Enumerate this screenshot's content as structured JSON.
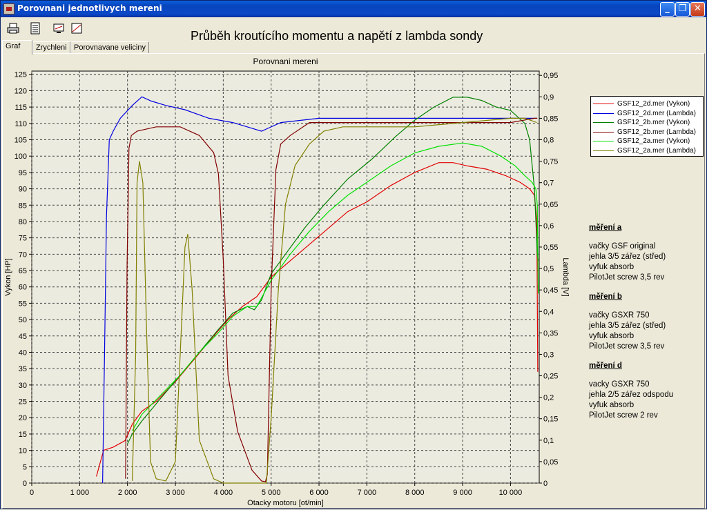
{
  "window": {
    "title": "Porovnani jednotlivych mereni",
    "controls": {
      "minimize": "_",
      "maximize": "❐",
      "close": "✕"
    }
  },
  "toolbar": {
    "buttons": [
      {
        "icon": "print-icon"
      },
      {
        "icon": "list-icon"
      },
      {
        "icon": "monitor-icon"
      },
      {
        "icon": "chart-icon"
      }
    ]
  },
  "heading": "Průběh kroutícího momentu a napětí z lambda sondy",
  "tabs": [
    {
      "label": "Graf",
      "active": true
    },
    {
      "label": "Zrychleni",
      "active": false
    },
    {
      "label": "Porovnavane veliciny",
      "active": false
    }
  ],
  "chart_data": {
    "type": "line",
    "title": "Porovnani mereni",
    "xlabel": "Otacky motoru [ot/min]",
    "ylabel": "Vykon [HP]",
    "y2label": "Lambda [V]",
    "xlim": [
      0,
      10600
    ],
    "ylim": [
      0,
      126
    ],
    "y2lim": [
      0,
      0.96
    ],
    "xticks": [
      0,
      1000,
      2000,
      3000,
      4000,
      5000,
      6000,
      7000,
      8000,
      9000,
      10000
    ],
    "xtick_labels": [
      "0",
      "1 000",
      "2 000",
      "3 000",
      "4 000",
      "5 000",
      "6 000",
      "7 000",
      "8 000",
      "9 000",
      "10 000"
    ],
    "yticks": [
      0,
      5,
      10,
      15,
      20,
      25,
      30,
      35,
      40,
      45,
      50,
      55,
      60,
      65,
      70,
      75,
      80,
      85,
      90,
      95,
      100,
      105,
      110,
      115,
      120,
      125
    ],
    "y2ticks": [
      0,
      0.05,
      0.1,
      0.15,
      0.2,
      0.25,
      0.3,
      0.35,
      0.4,
      0.45,
      0.5,
      0.55,
      0.6,
      0.65,
      0.7,
      0.75,
      0.8,
      0.85,
      0.9,
      0.95
    ],
    "y2tick_labels": [
      "0",
      "0,05",
      "0,1",
      "0,15",
      "0,2",
      "0,25",
      "0,3",
      "0,35",
      "0,4",
      "0,45",
      "0,5",
      "0,55",
      "0,6",
      "0,65",
      "0,7",
      "0,75",
      "0,8",
      "0,85",
      "0,9",
      "0,95"
    ],
    "grid": true,
    "legend_position": "right",
    "series": [
      {
        "name": "GSF12_2d.mer  (Vykon)",
        "color": "#e00000",
        "axis": "left",
        "x": [
          1350,
          1500,
          1700,
          1950,
          2100,
          2300,
          2600,
          3000,
          3400,
          3800,
          4100,
          4400,
          4700,
          5000,
          5400,
          5800,
          6200,
          6600,
          7000,
          7500,
          8000,
          8500,
          8800,
          9100,
          9500,
          9900,
          10200,
          10400,
          10500,
          10550,
          10570
        ],
        "y": [
          2,
          10,
          11,
          13,
          18,
          22,
          25,
          31,
          38,
          45,
          50,
          54,
          57,
          63,
          68,
          73,
          78,
          83,
          86,
          91,
          95,
          98,
          98,
          97,
          96,
          94,
          92,
          90,
          88,
          80,
          34
        ]
      },
      {
        "name": "GSF12_2d.mer  (Lambda)",
        "color": "#0000e0",
        "axis": "right",
        "x": [
          1480,
          1520,
          1560,
          1620,
          1700,
          1850,
          2100,
          2300,
          2500,
          2800,
          3200,
          3700,
          4200,
          4500,
          4800,
          5200,
          6000,
          7000,
          8000,
          9000,
          9600,
          10000,
          10400,
          10550
        ],
        "y": [
          0,
          0.3,
          0.62,
          0.8,
          0.82,
          0.85,
          0.88,
          0.9,
          0.89,
          0.88,
          0.87,
          0.85,
          0.84,
          0.83,
          0.82,
          0.84,
          0.85,
          0.85,
          0.85,
          0.85,
          0.85,
          0.85,
          0.85,
          0.85
        ]
      },
      {
        "name": "GSF12_2b.mer  (Vykon)",
        "color": "#008000",
        "axis": "left",
        "x": [
          2000,
          2100,
          2300,
          2700,
          3100,
          3500,
          3900,
          4200,
          4500,
          4650,
          4800,
          5000,
          5300,
          5700,
          6100,
          6600,
          7100,
          7600,
          8000,
          8400,
          8800,
          9100,
          9400,
          9700,
          10000,
          10300,
          10400,
          10500,
          10560,
          10580
        ],
        "y": [
          12,
          15,
          19,
          26,
          33,
          40,
          47,
          52,
          54,
          53,
          56,
          64,
          70,
          78,
          85,
          93,
          99,
          106,
          111,
          115,
          118,
          118,
          117,
          115,
          114,
          110,
          105,
          90,
          70,
          68
        ]
      },
      {
        "name": "GSF12_2b.mer  (Lambda)",
        "color": "#800000",
        "axis": "right",
        "x": [
          1960,
          1990,
          2030,
          2080,
          2200,
          2600,
          3100,
          3500,
          3800,
          3900,
          4000,
          4100,
          4300,
          4600,
          4800,
          4880,
          4920,
          5000,
          5100,
          5200,
          5400,
          5800,
          6400,
          7000,
          8000,
          9000,
          10000,
          10500,
          10560
        ],
        "y": [
          0.01,
          0.5,
          0.78,
          0.81,
          0.82,
          0.83,
          0.83,
          0.81,
          0.77,
          0.72,
          0.52,
          0.25,
          0.12,
          0.03,
          0.005,
          0.003,
          0.02,
          0.45,
          0.73,
          0.79,
          0.81,
          0.84,
          0.84,
          0.84,
          0.84,
          0.84,
          0.84,
          0.85,
          0.85
        ]
      },
      {
        "name": "GSF12_2a.mer  (Vykon)",
        "color": "#00e000",
        "axis": "left",
        "x": [
          2100,
          2300,
          2700,
          3100,
          3500,
          3900,
          4200,
          4500,
          4700,
          5000,
          5400,
          5800,
          6200,
          6600,
          7000,
          7500,
          8000,
          8500,
          9000,
          9400,
          9800,
          10100,
          10300,
          10450,
          10530,
          10560,
          10580
        ],
        "y": [
          16,
          21,
          27,
          33,
          40,
          46,
          51,
          54,
          54,
          62,
          70,
          77,
          83,
          88,
          92,
          97,
          101,
          103,
          104,
          103,
          100,
          97,
          94,
          92,
          90,
          85,
          58
        ]
      },
      {
        "name": "GSF12_2a.mer  (Lambda)",
        "color": "#808000",
        "axis": "right",
        "x": [
          2100,
          2170,
          2200,
          2250,
          2320,
          2400,
          2480,
          2600,
          2800,
          3000,
          3100,
          3200,
          3260,
          3350,
          3500,
          3800,
          4000,
          4900,
          5000,
          5150,
          5300,
          5500,
          5800,
          6100,
          6500,
          7000,
          8000,
          9000,
          10000,
          10300,
          10550
        ],
        "y": [
          0.005,
          0.3,
          0.7,
          0.75,
          0.7,
          0.35,
          0.05,
          0.01,
          0.005,
          0.05,
          0.3,
          0.55,
          0.58,
          0.45,
          0.1,
          0.01,
          0.0,
          0.0,
          0.15,
          0.45,
          0.65,
          0.74,
          0.79,
          0.82,
          0.83,
          0.83,
          0.83,
          0.84,
          0.85,
          0.85,
          0.84
        ]
      }
    ]
  },
  "notes": [
    {
      "title": "měření a",
      "lines": [
        "vačky GSF original",
        "jehla 3/5 zářez (střed)",
        "vyfuk absorb",
        "PilotJet screw 3,5 rev"
      ]
    },
    {
      "title": "měření b",
      "lines": [
        "vačky GSXR 750",
        "jehla 3/5 zářez (střed)",
        "vyfuk absorb",
        "PilotJet screw 3,5 rev"
      ]
    },
    {
      "title": "měření d",
      "lines": [
        "vacky GSXR 750",
        "jehla 2/5 zářez odspodu",
        "vyfuk absorb",
        "PilotJet screw 2 rev"
      ]
    }
  ]
}
